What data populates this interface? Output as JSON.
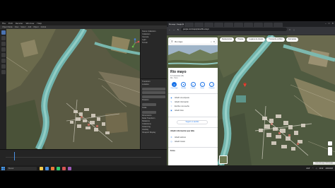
{
  "blender": {
    "menu": [
      "File",
      "Edit",
      "Render",
      "Window",
      "Help"
    ],
    "header": [
      "Object Mode",
      "View",
      "Select",
      "Add",
      "Object",
      "Global"
    ],
    "outliner_rows": [
      "Scene Collection",
      "Collection",
      "Camera",
      "Light",
      "Terrain"
    ],
    "props_labels": [
      "Transform",
      "Location",
      "Rotation",
      "Scale",
      "Dimensions",
      "Delta Transform",
      "Relations",
      "Collections",
      "Instancing",
      "Visibility",
      "Viewport Display"
    ]
  },
  "browser": {
    "tabs": [
      "",
      "",
      "",
      "",
      "",
      "",
      "",
      "",
      "",
      "",
      "",
      ""
    ],
    "active_tab": "Rio mayo - Google Maps",
    "url": "google.com/maps/place/Rio+mayo",
    "window_controls": [
      "–",
      "□",
      "✕"
    ]
  },
  "maps": {
    "search": {
      "value": "Rio mayo"
    },
    "place": {
      "name": "Río mayo",
      "rating": "4.6 ★★★★★ (16)",
      "type": "Río · Perú"
    },
    "actions": [
      {
        "label": "Cómo llegar",
        "icon": "directions-icon",
        "glyph": "➜"
      },
      {
        "label": "Guardar",
        "icon": "bookmark-icon",
        "glyph": "⚑"
      },
      {
        "label": "Cercano",
        "icon": "nearby-icon",
        "glyph": "◎"
      },
      {
        "label": "Enviar",
        "icon": "send-to-phone-icon",
        "glyph": "▯"
      },
      {
        "label": "Compartir",
        "icon": "share-icon",
        "glyph": "⤴"
      }
    ],
    "info": [
      {
        "icon": "location-pin-icon",
        "glyph": "◉",
        "text": "Añadir una etiqueta"
      },
      {
        "icon": "pencil-icon",
        "glyph": "✎",
        "text": "Añadir información"
      },
      {
        "icon": "star-icon",
        "glyph": "☆",
        "text": "Escribe una reseña"
      },
      {
        "icon": "photo-icon",
        "glyph": "▣",
        "text": "Añadir fotos"
      }
    ],
    "suggest_button": "Sugerir un cambio",
    "section_heading": "Añadir información que falta",
    "info2": [
      {
        "icon": "phone-icon",
        "glyph": "✆",
        "text": "Añadir teléfono"
      },
      {
        "icon": "clock-icon",
        "glyph": "◷",
        "text": "Añadir horario"
      }
    ],
    "photos_heading": "Fotos",
    "chips": [
      "Restaurantes",
      "Hoteles",
      "Lugares de interés",
      "Transporte público",
      "Farmacias"
    ],
    "footer": "Datos del mapa ©2023 Google"
  },
  "taskbar": {
    "search_placeholder": "Buscar",
    "time": "10:32",
    "date": "4/02/2023",
    "lang": "ESP",
    "app_colors": [
      "#f2c94c",
      "#4a90e2",
      "#e8793b",
      "#2ecc71",
      "#d35454",
      "#9b59b6"
    ]
  }
}
